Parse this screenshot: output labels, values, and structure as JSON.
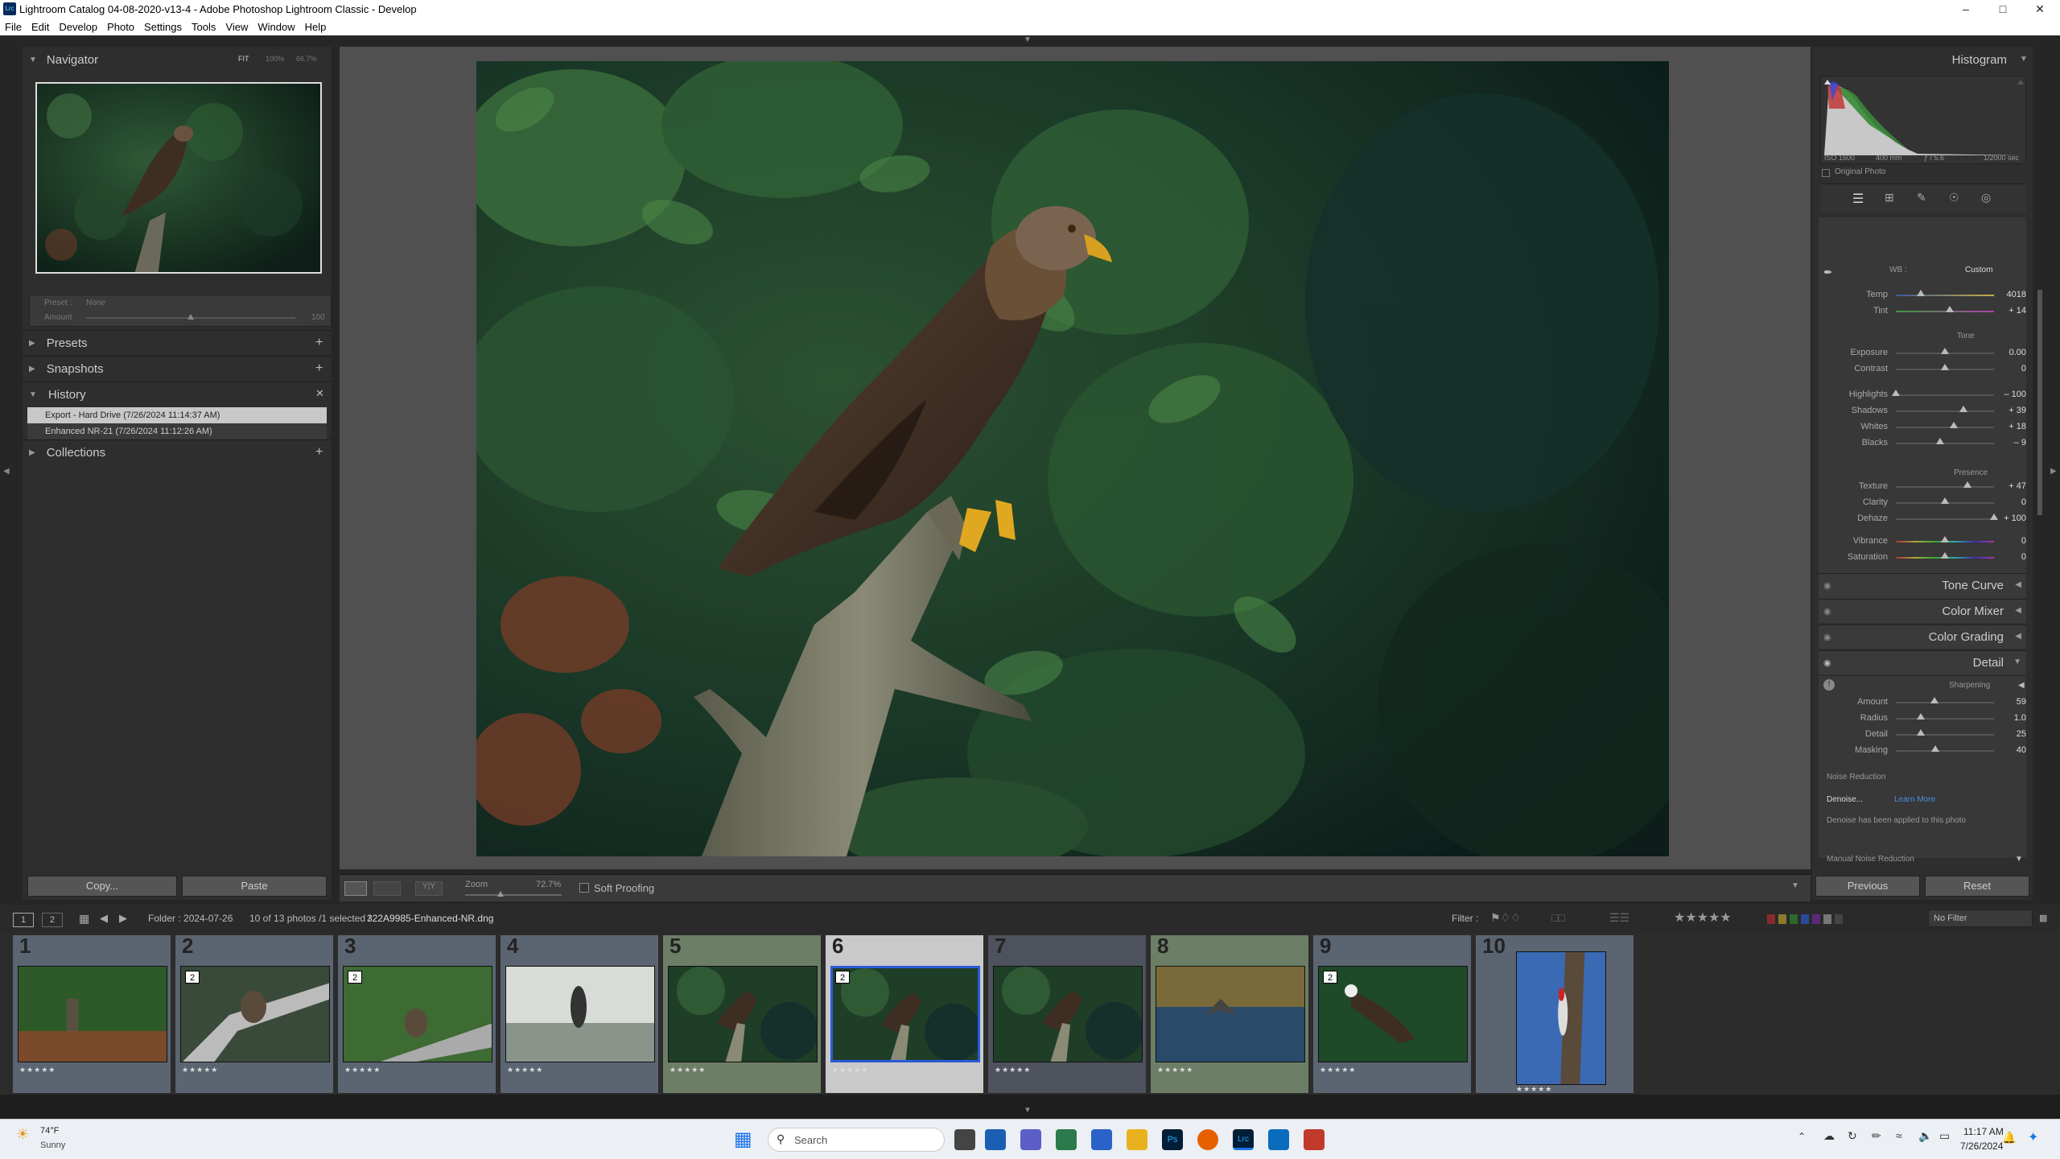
{
  "window": {
    "title": "Lightroom Catalog 04-08-2020-v13-4 - Adobe Photoshop Lightroom Classic - Develop",
    "app_icon": "Lrc"
  },
  "menu": [
    "File",
    "Edit",
    "Develop",
    "Photo",
    "Settings",
    "Tools",
    "View",
    "Window",
    "Help"
  ],
  "navigator": {
    "title": "Navigator",
    "zoom_options": [
      "FIT",
      "100%",
      "66.7%"
    ]
  },
  "preset_row": {
    "label": "Preset :",
    "value": "None",
    "amount_label": "Amount",
    "amount_value": "100"
  },
  "left_sections": {
    "presets": "Presets",
    "snapshots": "Snapshots",
    "history": "History",
    "collections": "Collections"
  },
  "history": [
    "Export - Hard Drive (7/26/2024 11:14:37 AM)",
    "Enhanced NR-21 (7/26/2024 11:12:26 AM)"
  ],
  "left_buttons": {
    "copy": "Copy...",
    "paste": "Paste"
  },
  "toolbar": {
    "zoom_label": "Zoom",
    "zoom_value": "72.7%",
    "soft_proofing": "Soft Proofing"
  },
  "histogram": {
    "title": "Histogram",
    "iso": "ISO 1600",
    "focal": "400 mm",
    "aperture": "ƒ / 5.6",
    "shutter": "1/2000 sec",
    "original_photo": "Original Photo"
  },
  "basic": {
    "wb_label": "WB :",
    "wb_value": "Custom",
    "temp": {
      "label": "Temp",
      "value": "4018",
      "pos": 0.25
    },
    "tint": {
      "label": "Tint",
      "value": "+ 14",
      "pos": 0.55
    },
    "tone_header": "Tone",
    "exposure": {
      "label": "Exposure",
      "value": "0.00",
      "pos": 0.5
    },
    "contrast": {
      "label": "Contrast",
      "value": "0",
      "pos": 0.5
    },
    "highlights": {
      "label": "Highlights",
      "value": "– 100",
      "pos": 0.0
    },
    "shadows": {
      "label": "Shadows",
      "value": "+ 39",
      "pos": 0.69
    },
    "whites": {
      "label": "Whites",
      "value": "+ 18",
      "pos": 0.59
    },
    "blacks": {
      "label": "Blacks",
      "value": "– 9",
      "pos": 0.45
    },
    "presence_header": "Presence",
    "texture": {
      "label": "Texture",
      "value": "+ 47",
      "pos": 0.73
    },
    "clarity": {
      "label": "Clarity",
      "value": "0",
      "pos": 0.5
    },
    "dehaze": {
      "label": "Dehaze",
      "value": "+ 100",
      "pos": 1.0
    },
    "vibrance": {
      "label": "Vibrance",
      "value": "0",
      "pos": 0.5
    },
    "saturation": {
      "label": "Saturation",
      "value": "0",
      "pos": 0.5
    }
  },
  "right_sections": {
    "tone_curve": "Tone Curve",
    "color_mixer": "Color Mixer",
    "color_grading": "Color Grading",
    "detail": "Detail"
  },
  "detail": {
    "sharpening_header": "Sharpening",
    "amount": {
      "label": "Amount",
      "value": "59",
      "pos": 0.39
    },
    "radius": {
      "label": "Radius",
      "value": "1.0",
      "pos": 0.25
    },
    "detail": {
      "label": "Detail",
      "value": "25",
      "pos": 0.25
    },
    "masking": {
      "label": "Masking",
      "value": "40",
      "pos": 0.4
    },
    "noise_reduction": "Noise Reduction",
    "denoise_button": "Denoise...",
    "learn_more": "Learn More",
    "denoise_note": "Denoise has been applied to this photo",
    "manual_nr": "Manual Noise Reduction"
  },
  "right_buttons": {
    "previous": "Previous",
    "reset": "Reset"
  },
  "filmbar": {
    "page1": "1",
    "page2": "2",
    "folder": "Folder : 2024-07-26",
    "count": "10 of 13 photos /1 selected /",
    "filename": "322A9985-Enhanced-NR.dng",
    "filter_label": "Filter :",
    "no_filter": "No Filter"
  },
  "film_cells": [
    {
      "num": "1",
      "badge": "",
      "stars": "★★★★★",
      "bg": "#5b6471",
      "scene": "heron-fence"
    },
    {
      "num": "2",
      "badge": "2",
      "stars": "★★★★★",
      "bg": "#5b6471",
      "scene": "heron-branch"
    },
    {
      "num": "3",
      "badge": "2",
      "stars": "★★★★★",
      "bg": "#5b6471",
      "scene": "heron-log"
    },
    {
      "num": "4",
      "badge": "",
      "stars": "★★★★★",
      "bg": "#5b6471",
      "scene": "cormorant"
    },
    {
      "num": "5",
      "badge": "",
      "stars": "★★★★★",
      "bg": "#6c7e66",
      "scene": "eagle"
    },
    {
      "num": "6",
      "badge": "2",
      "stars": "★★★★★",
      "bg": "#c9c9c9",
      "scene": "eagle"
    },
    {
      "num": "7",
      "badge": "",
      "stars": "★★★★★",
      "bg": "#4e525c",
      "scene": "eagle"
    },
    {
      "num": "8",
      "badge": "",
      "stars": "★★★★★",
      "bg": "#6c7e66",
      "scene": "osprey-water"
    },
    {
      "num": "9",
      "badge": "2",
      "stars": "★★★★★",
      "bg": "#5b6471",
      "scene": "eagle-flight"
    },
    {
      "num": "10",
      "badge": "",
      "stars": "★★★★★",
      "bg": "#5b6471",
      "scene": "woodpecker"
    }
  ],
  "taskbar": {
    "temp": "74°F",
    "weather": "Sunny",
    "search": "Search",
    "time": "11:17 AM",
    "date": "7/26/2024"
  }
}
